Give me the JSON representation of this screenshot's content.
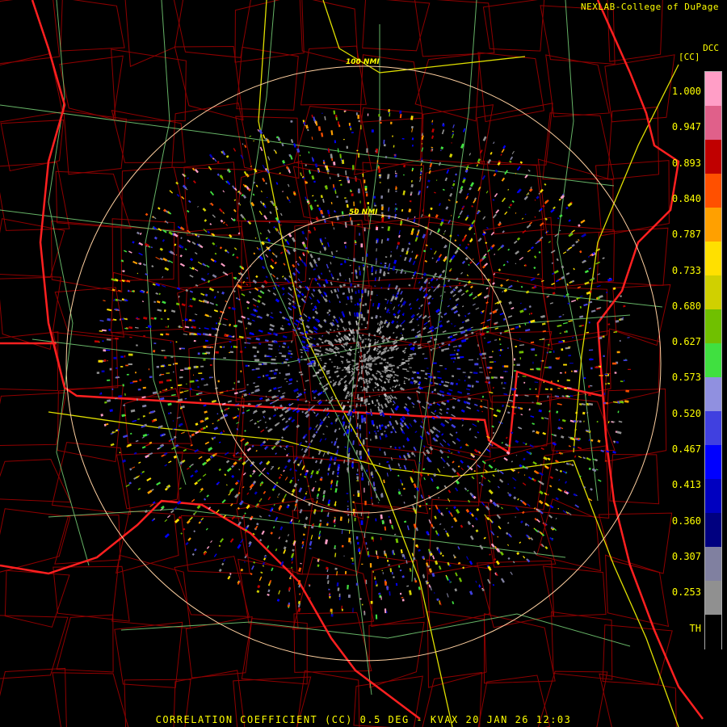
{
  "header": {
    "credit": "NEXLAB-College of DuPage"
  },
  "footer": {
    "caption": "CORRELATION COEFFICIENT (CC) 0.5 DEG - KVAX 20 JAN 26 12:03"
  },
  "range_rings": [
    "100 NMI",
    "50 NMI"
  ],
  "legend": {
    "product_code": "DCC",
    "unit": "[CC]",
    "ticks": [
      "1.000",
      "0.947",
      "0.893",
      "0.840",
      "0.787",
      "0.733",
      "0.680",
      "0.627",
      "0.573",
      "0.520",
      "0.467",
      "0.413",
      "0.360",
      "0.307",
      "0.253",
      "TH"
    ],
    "colors": [
      "#ff9ec6",
      "#e0608a",
      "#c00000",
      "#ff5000",
      "#ffa000",
      "#ffe000",
      "#d0d000",
      "#70c000",
      "#40e040",
      "#9090e0",
      "#4040e0",
      "#0000ff",
      "#0000c0",
      "#000080",
      "#8080a0",
      "#909090",
      "#000000"
    ]
  },
  "colors": {
    "state_border": "#ff2020",
    "county_border": "#a00000",
    "highway": "#e0e000",
    "road": "#80e080",
    "ring": "#ffd0a0",
    "background": "#000000"
  }
}
